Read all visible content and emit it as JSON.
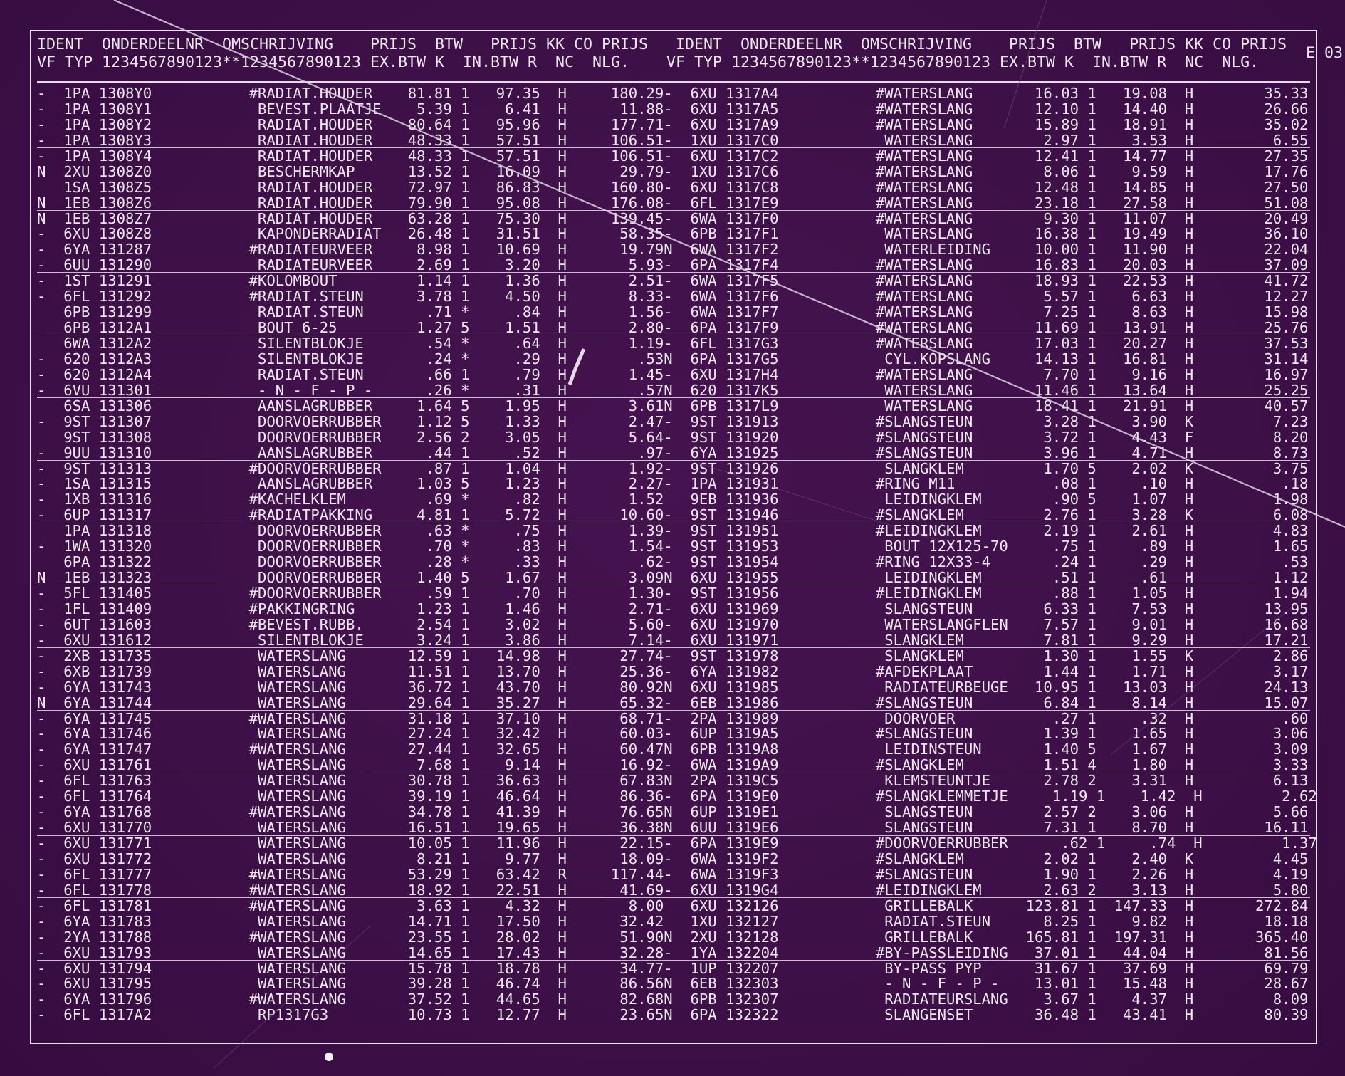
{
  "header": {
    "line1": "IDENT  ONDERDEELNR  OMSCHRIJVING    PRIJS  BTW   PRIJS KK CO PRIJS   IDENT  ONDERDEELNR  OMSCHRIJVING    PRIJS  BTW   PRIJS KK CO PRIJS",
    "line2": "VF TYP 1234567890123**1234567890123 EX.BTW K  IN.BTW R  NC  NLG.    VF TYP 1234567890123**1234567890123 EX.BTW K  IN.BTW R  NC  NLG.",
    "page_code": "E 03"
  },
  "rows": [
    "-  1PA 1308Y0           #RADIAT.HOUDER    81.81 1   97.35  H     180.29-  6XU 1317A4           #WATERSLANG       16.03 1   19.08  H        35.33",
    "-  1PA 1308Y1            BEVEST.PLAATJE    5.39 1    6.41  H      11.88-  6XU 1317A5           #WATERSLANG       12.10 1   14.40  H        26.66",
    "-  1PA 1308Y2            RADIAT.HOUDER    80.64 1   95.96  H     177.71-  6XU 1317A9           #WATERSLANG       15.89 1   18.91  H        35.02",
    "-  1PA 1308Y3            RADIAT.HOUDER    48.33 1   57.51  H     106.51-  1XU 1317C0            WATERSLANG        2.97 1    3.53  H         6.55",
    "-  1PA 1308Y4            RADIAT.HOUDER    48.33 1   57.51  H     106.51-  6XU 1317C2           #WATERSLANG       12.41 1   14.77  H        27.35",
    "N  2XU 1308Z0            BESCHERMKAP      13.52 1   16.09  H      29.79-  1XU 1317C6           #WATERSLANG        8.06 1    9.59  H        17.76",
    "   1SA 1308Z5            RADIAT.HOUDER    72.97 1   86.83  H     160.80-  6XU 1317C8           #WATERSLANG       12.48 1   14.85  H        27.50",
    "N  1EB 1308Z6            RADIAT.HOUDER    79.90 1   95.08  H     176.08-  6FL 1317E9           #WATERSLANG       23.18 1   27.58  H        51.08",
    "N  1EB 1308Z7            RADIAT.HOUDER    63.28 1   75.30  H     139.45-  6WA 1317F0           #WATERSLANG        9.30 1   11.07  H        20.49",
    "-  6XU 1308Z8            KAPONDERRADIAT   26.48 1   31.51  H      58.35-  6PB 1317F1            WATERSLANG       16.38 1   19.49  H        36.10",
    "-  6YA 131287           #RADIATEURVEER     8.98 1   10.69  H      19.79N  6WA 1317F2            WATERLEIDING     10.00 1   11.90  H        22.04",
    "-  6UU 131290            RADIATEURVEER     2.69 1    3.20  H       5.93-  6PA 1317F4           #WATERSLANG       16.83 1   20.03  H        37.09",
    "-  1ST 131291           #KOLOMBOUT         1.14 1    1.36  H       2.51-  6WA 1317F5           #WATERSLANG       18.93 1   22.53  H        41.72",
    "-  6FL 131292           #RADIAT.STEUN      3.78 1    4.50  H       8.33-  6WA 1317F6           #WATERSLANG        5.57 1    6.63  H        12.27",
    "   6PB 131299            RADIAT.STEUN       .71 *     .84  H       1.56-  6WA 1317F7           #WATERSLANG        7.25 1    8.63  H        15.98",
    "   6PB 1312A1            BOUT 6-25         1.27 5    1.51  H       2.80-  6PA 1317F9           #WATERSLANG       11.69 1   13.91  H        25.76",
    "   6WA 1312A2            SILENTBLOKJE       .54 *     .64  H       1.19-  6FL 1317G3           #WATERSLANG       17.03 1   20.27  H        37.53",
    "-  620 1312A3            SILENTBLOKJE       .24 *     .29  H        .53N  6PA 1317G5            CYL.KOPSLANG     14.13 1   16.81  H        31.14",
    "-  620 1312A4            RADIAT.STEUN       .66 1     .79  H       1.45-  6XU 1317H4           #WATERSLANG        7.70 1    9.16  H        16.97",
    "-  6VU 131301            - N - F - P -      .26 *     .31  H        .57N  620 1317K5            WATERSLANG       11.46 1   13.64  H        25.25",
    "   6SA 131306            AANSLAGRUBBER     1.64 5    1.95  H       3.61N  6PB 1317L9            WATERSLANG       18.41 1   21.91  H        40.57",
    "-  9ST 131307            DOORVOERRUBBER    1.12 5    1.33  H       2.47-  9ST 131913           #SLANGSTEUN        3.28 1    3.90  K         7.23",
    "   9ST 131308            DOORVOERRUBBER    2.56 2    3.05  H       5.64-  9ST 131920           #SLANGSTEUN        3.72 1    4.43  F         8.20",
    "-  9UU 131310            AANSLAGRUBBER      .44 1     .52  H        .97-  6YA 131925           #SLANGSTEUN        3.96 1    4.71  H         8.73",
    "-  9ST 131313           #DOORVOERRUBBER     .87 1    1.04  H       1.92-  9ST 131926            SLANGKLEM         1.70 5    2.02  K         3.75",
    "-  1SA 131315            AANSLAGRUBBER     1.03 5    1.23  H       2.27-  1PA 131931           #RING M11           .08 1     .10  H          .18",
    "-  1XB 131316           #KACHELKLEM         .69 *     .82  H       1.52   9EB 131936            LEIDINGKLEM        .90 5    1.07  H         1.98",
    "-  6UP 131317           #RADIATPAKKING     4.81 1    5.72  H      10.60-  9ST 131946           #SLANGKLEM         2.76 1    3.28  K         6.08",
    "   1PA 131318            DOORVOERRUBBER     .63 *     .75  H       1.39-  9ST 131951           #LEIDINGKLEM       2.19 1    2.61  H         4.83",
    "-  1WA 131320            DOORVOERRUBBER     .70 *     .83  H       1.54-  9ST 131953            BOUT 12X125-70     .75 1     .89  H         1.65",
    "   6PA 131322            DOORVOERRUBBER     .28 *     .33  H        .62-  9ST 131954           #RING 12X33-4       .24 1     .29  H          .53",
    "N  1EB 131323            DOORVOERRUBBER    1.40 5    1.67  H       3.09N  6XU 131955            LEIDINGKLEM        .51 1     .61  H         1.12",
    "-  5FL 131405           #DOORVOERRUBBER     .59 1     .70  H       1.30-  9ST 131956           #LEIDINGKLEM        .88 1    1.05  H         1.94",
    "-  1FL 131409           #PAKKINGRING       1.23 1    1.46  H       2.71-  6XU 131969            SLANGSTEUN        6.33 1    7.53  H        13.95",
    "-  6UT 131603           #BEVEST.RUBB.      2.54 1    3.02  H       5.60-  6XU 131970            WATERSLANGFLEN    7.57 1    9.01  H        16.68",
    "-  6XU 131612            SILENTBLOKJE      3.24 1    3.86  H       7.14-  6XU 131971            SLANGKLEM         7.81 1    9.29  H        17.21",
    "-  2XB 131735            WATERSLANG       12.59 1   14.98  H      27.74-  9ST 131978            SLANGKLEM         1.30 1    1.55  K         2.86",
    "-  6XB 131739            WATERSLANG       11.51 1   13.70  H      25.36-  6YA 131982           #AFDEKPLAAT        1.44 1    1.71  H         3.17",
    "-  6YA 131743            WATERSLANG       36.72 1   43.70  H      80.92N  6XU 131985            RADIATEURBEUGE   10.95 1   13.03  H        24.13",
    "N  6YA 131744            WATERSLANG       29.64 1   35.27  H      65.32-  6EB 131986           #SLANGSTEUN        6.84 1    8.14  H        15.07",
    "-  6YA 131745           #WATERSLANG       31.18 1   37.10  H      68.71-  2PA 131989            DOORVOER           .27 1     .32  H          .60",
    "-  6YA 131746            WATERSLANG       27.24 1   32.42  H      60.03-  6UP 1319A5           #SLANGSTEUN        1.39 1    1.65  H         3.06",
    "-  6YA 131747           #WATERSLANG       27.44 1   32.65  H      60.47N  6PB 1319A8            LEIDINSTEUN       1.40 5    1.67  H         3.09",
    "-  6XU 131761            WATERSLANG        7.68 1    9.14  H      16.92-  6WA 1319A9           #SLANGKLEM         1.51 4    1.80  H         3.33",
    "-  6FL 131763            WATERSLANG       30.78 1   36.63  H      67.83N  2PA 1319C5            KLEMSTEUNTJE      2.78 2    3.31  H         6.13",
    "-  6FL 131764            WATERSLANG       39.19 1   46.64  H      86.36-  6PA 1319E0           #SLANGKLEMMETJE     1.19 1    1.42  H         2.62",
    "-  6YA 131768           #WATERSLANG       34.78 1   41.39  H      76.65N  6UP 1319E1            SLANGSTEUN        2.57 2    3.06  H         5.66",
    "-  6XU 131770            WATERSLANG       16.51 1   19.65  H      36.38N  6UU 1319E6            SLANGSTEUN        7.31 1    8.70  H        16.11",
    "-  6XU 131771            WATERSLANG       10.05 1   11.96  H      22.15-  6PA 1319E9           #DOORVOERRUBBER      .62 1     .74  H         1.37",
    "-  6XU 131772            WATERSLANG        8.21 1    9.77  H      18.09-  6WA 1319F2           #SLANGKLEM         2.02 1    2.40  K         4.45",
    "-  6FL 131777           #WATERSLANG       53.29 1   63.42  R     117.44-  6WA 1319F3           #SLANGSTEUN        1.90 1    2.26  H         4.19",
    "-  6FL 131778           #WATERSLANG       18.92 1   22.51  H      41.69-  6XU 1319G4           #LEIDINGKLEM       2.63 2    3.13  H         5.80",
    "-  6FL 131781           #WATERSLANG        3.63 1    4.32  H       8.00   6XU 132126            GRILLEBALK      123.81 1  147.33  H       272.84",
    "-  6YA 131783            WATERSLANG       14.71 1   17.50  H      32.42   1XU 132127            RADIAT.STEUN      8.25 1    9.82  H        18.18",
    "-  2YA 131788           #WATERSLANG       23.55 1   28.02  H      51.90N  2XU 132128            GRILLEBALK      165.81 1  197.31  H       365.40",
    "-  6XU 131793            WATERSLANG       14.65 1   17.43  H      32.28-  1YA 132204           #BY-PASSLEIDING   37.01 1   44.04  H        81.56",
    "-  6XU 131794            WATERSLANG       15.78 1   18.78  H      34.77-  1UP 132207            BY-PASS PYP      31.67 1   37.69  H        69.79",
    "-  6XU 131795            WATERSLANG       39.28 1   46.74  H      86.56N  6EB 132303            - N - F - P -    13.01 1   15.48  H        28.67",
    "-  6YA 131796           #WATERSLANG       37.52 1   44.65  H      82.68N  6PB 132307            RADIATEURSLANG    3.67 1    4.37  H         8.09",
    "-  6FL 1317A2            RP1317G3         10.73 1   12.77  H      23.65N  6PA 132322            SLANGENSET       36.48 1   43.41  H        80.39"
  ]
}
